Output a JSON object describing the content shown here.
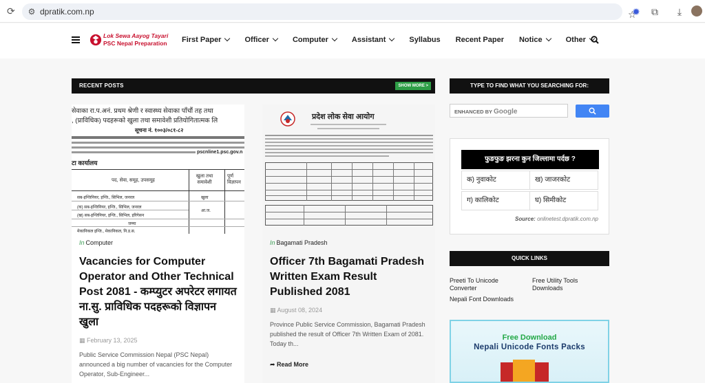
{
  "browser": {
    "url": "dpratik.com.np"
  },
  "site": {
    "logo_line1": "Lok Sewa Aayog Tayari",
    "logo_line2": "PSC Nepal Preparation",
    "nav": [
      {
        "label": "First Paper",
        "dropdown": true
      },
      {
        "label": "Officer",
        "dropdown": true
      },
      {
        "label": "Computer",
        "dropdown": true
      },
      {
        "label": "Assistant",
        "dropdown": true
      },
      {
        "label": "Syllabus",
        "dropdown": false
      },
      {
        "label": "Recent Paper",
        "dropdown": false
      },
      {
        "label": "Notice",
        "dropdown": true
      },
      {
        "label": "Other",
        "dropdown": true
      }
    ]
  },
  "recent": {
    "title": "RECENT POSTS",
    "show_more": "SHOW MORE >"
  },
  "posts": [
    {
      "in": "In",
      "category": "Computer",
      "title": "Vacancies for Computer Operator and Other Technical Post 2081 - कम्प्युटर अपरेटर लगायत ना.सु. प्राविधिक पदहरूको विज्ञापन खुला",
      "date": "February 13, 2025",
      "excerpt": "Public Service Commission Nepal (PSC Nepal) announced a big number of vacancies for the Computer Operator, Sub-Engineer...",
      "image_text": {
        "l1": "सेवाका रा.प.अनं. प्रथम श्रेणी र स्वास्थ्य सेवाका पाँचौं तह तथा",
        "l2": ", (प्राविधिक) पदहरूको खुला तथा समावेशी प्रतियोगितात्मक लि",
        "l3": "सूचना नं. १००३/०८१-८२",
        "l4": "pscnline1.psc.gov.n",
        "l5": "टा कार्यालय",
        "th1": "पद, सेवा, समूह, उपसमूह",
        "th2": "खुला तथा समावेशी",
        "th3": "पूर्ण विज्ञापन",
        "r1": "सब-इन्जिनियर, इन्जि., सिभिल, जनरल",
        "r1b": "खुला",
        "r2": "(क) सब-इन्जिनियर, इन्जि., सिभिल, जनरल",
        "r2b": "आ.ज.",
        "r3": "(ख) सब-इन्जिनियर, इन्जि., सिभिल, इरिगेसन",
        "r4": "जम्मा",
        "r5": "मेकानिकल इन्जि., मेकानिकल, नि.ड.स."
      }
    },
    {
      "in": "In",
      "category": "Bagamati Pradesh",
      "title": "Officer 7th Bagamati Pradesh Written Exam Result Published 2081",
      "date": "August 08, 2024",
      "excerpt": "Province Public Service Commission, Bagamati Pradesh published the result of Officer 7th Written Exam of 2081. Today th...",
      "read_more": "Read More",
      "image_text": {
        "heading": "प्रदेश लोक सेवा आयोग"
      }
    }
  ],
  "sidebar": {
    "search_title": "TYPE TO FIND WHAT YOU SEARCHING FOR:",
    "search_placeholder": "ENHANCED BY",
    "search_brand": "Google",
    "quiz": {
      "question": "फुङफुङ झरना कुन जिल्लामा पर्दछ ?",
      "options": [
        "क) नुवाकोट",
        "ख) जाजरकोट",
        "ग) कालिकोट",
        "घ) सिमीकोट"
      ],
      "source_label": "Source:",
      "source": "onlinetest.dpratik.com.np"
    },
    "quick_links_title": "QUICK LINKS",
    "quick_links": [
      "Preeti To Unicode Converter",
      "Free Utility Tools Downloads",
      "Nepali Font Downloads"
    ],
    "promo": {
      "line1": "Free Download",
      "line2": "Nepali Unicode Fonts Packs"
    }
  },
  "colors": {
    "accent_green": "#2e9e47",
    "brand_red": "#c8102e",
    "google_blue": "#4285f4"
  }
}
